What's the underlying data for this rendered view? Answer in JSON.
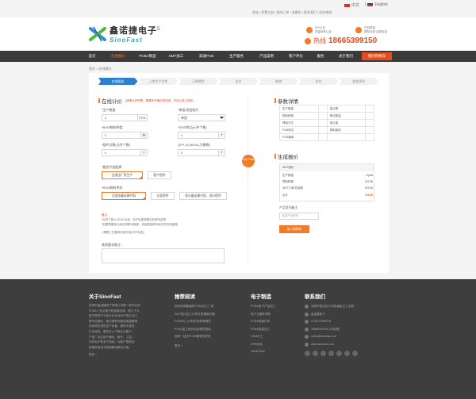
{
  "topbar": {
    "links": "登录 | 免费注册 | 我的订单 | 收藏夹 | 联系我们 | 网站地图",
    "lang_cn": "中文",
    "lang_en": "English"
  },
  "header": {
    "logo_cn": "鑫诺捷电子",
    "logo_en": "SinoFast",
    "badge": "5",
    "box1_line1": "ISO认证",
    "box1_line2": "质量体系认证",
    "box2_line1": "产品质量",
    "box2_line2": "国际标准·品质保证",
    "hotline_label": "热线",
    "hotline_number": "18665399150"
  },
  "nav": {
    "items": [
      "首页",
      "在线报价",
      "PCBA制造",
      "SMT加工",
      "高速PCB",
      "生产服务",
      "产品案例",
      "客户评价",
      "服务",
      "关于我们"
    ],
    "cart": "我的购物车"
  },
  "breadcrumb": "首页 > 在线报价",
  "steps": [
    "在线报价",
    "上传生产文件",
    "订单提交",
    "支付",
    "制造",
    "交付",
    "收货评价"
  ],
  "form": {
    "title": "在线计价",
    "title_note": "(请确认好所需，需要有不懂的请咨询，可选以线上操作)",
    "qty_label": "*生产数量",
    "qty_value": "0",
    "qty_unit": "PCS",
    "model_label": "*单面/双面贴片",
    "model_value": "单面",
    "bom_label": "*BOM物料种类",
    "bom_value": "0",
    "bom_unit": "种",
    "smt_label": "*SMT焊点(元件个数)",
    "smt_value": "0",
    "smt_unit": "个",
    "plug_label": "*插件点数(元件个数)",
    "plug_value": "0",
    "plug_unit": "个",
    "qfp_label": "QFP (IC)/BGA (引脚数)",
    "qfp_value": "0",
    "qfp_unit": "个",
    "supply_label": "*备货代加配焊",
    "supply_options": [
      "全部由厂家生产",
      "客户提供"
    ],
    "bom_supply_label": "*BOM物料供应",
    "bom_supply_options": [
      "全部由鑫诺捷代购",
      "全部提供",
      "部分鑫诺捷代购，部分提供"
    ],
    "notes_title": "备注：",
    "note1": "*元件个数以 BOM 为准，电子料费按照实际情况结算",
    "note2": "*如果需要拆分组合请联系客服，或者直接联系我们的在线客服",
    "note3": "• 需要工艺要求的请打钩(可不勾选)",
    "remark_label": "其他要求备注：",
    "calc_btn": "Pay Price"
  },
  "params": {
    "title": "参数详情",
    "rows": [
      [
        "生产数量",
        "贴片数"
      ],
      [
        "物料种类",
        "焊点数量"
      ],
      [
        "焊接方式",
        "贴片费"
      ],
      [
        "PCB测试",
        "物料费用"
      ],
      [
        "PCB钢网",
        ""
      ]
    ]
  },
  "quote": {
    "title": "生成报价",
    "head": "SMT报价",
    "rows": [
      [
        "生产数量",
        "0 pcs"
      ],
      [
        "物料种类",
        "¥ 0.00"
      ],
      [
        "SMT订单/总金额",
        "¥ 0.00"
      ],
      [
        "合计",
        "¥ 0.00"
      ]
    ],
    "remark_label": "产品型号备注",
    "remark_placeholder": "选择产品型号",
    "cart_btn": "加入购物车"
  },
  "footer": {
    "about_title": "关于SinoFast",
    "about_text": "深圳市鑫诺捷电子有限公司是一家专业的\nPCBA一站式电子制造服务商，致力于为\n客户提供PCB设计优化及SMT贴片加工\n等专业服务，我们拥有完善的质量管理\n体系和先进的生产设备，拥有丰富的\n行业经验，服务过上千家企业客户，\n产品广泛应用于通讯、医疗、工控、\n汽车电子等多个领域，为客户提供优\n质高效的电子制造服务解决方案。",
    "about_more": "更多 >",
    "reading_title": "推荐阅读",
    "reading_items": [
      "如何选择靠谱的PCBA加工厂家",
      "SMT贴片加工中常见的焊接问题",
      "PCBA代工代料的优势有哪些",
      "PCBA加工报价包含哪些费用",
      "选择一站式PCBA服务的好处"
    ],
    "reading_more": "更多 >",
    "mfg_title": "电子制造",
    "mfg_items": [
      "PCBA电子产品加工",
      "电子元器件采购",
      "PCBA快速打样",
      "PCBA批量加工",
      "OEM代工",
      "DFM优化",
      "OEM/ODM"
    ],
    "contact_title": "联系我们",
    "contact_items": [
      "深圳市宝安区沙井街道民主工业园",
      "鑫诺捷电子",
      "0755-27949976",
      "18665399150 (刘经理)",
      "sales@sinofast.com",
      "www.sinofast.com"
    ]
  }
}
